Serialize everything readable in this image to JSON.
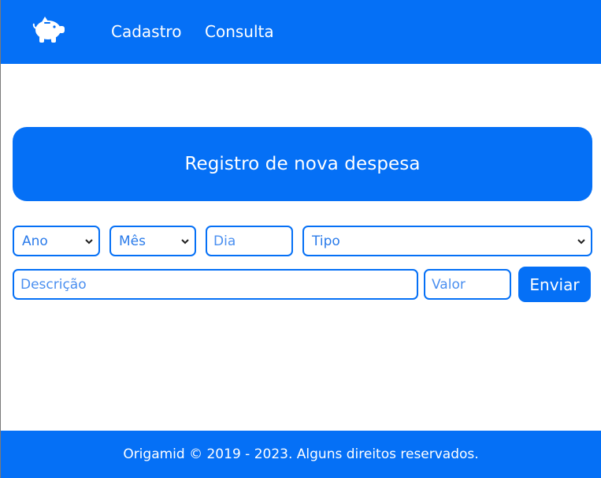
{
  "header": {
    "logo_icon": "piggy-bank-icon",
    "nav": [
      {
        "label": "Cadastro"
      },
      {
        "label": "Consulta"
      }
    ]
  },
  "main": {
    "title": "Registro de nova despesa",
    "form": {
      "ano": {
        "selected": "Ano"
      },
      "mes": {
        "selected": "Mês"
      },
      "dia": {
        "placeholder": "Dia"
      },
      "tipo": {
        "selected": "Tipo"
      },
      "descricao": {
        "placeholder": "Descrição"
      },
      "valor": {
        "placeholder": "Valor"
      },
      "submit_label": "Enviar"
    }
  },
  "footer": {
    "text": "Origamid © 2019 - 2023. Alguns direitos reservados."
  },
  "colors": {
    "primary": "#0570f6",
    "background": "#ffffff",
    "field_text": "#2a7bea"
  }
}
